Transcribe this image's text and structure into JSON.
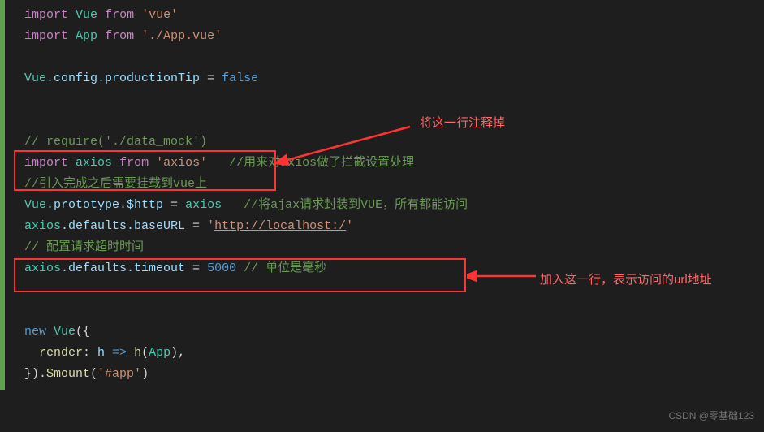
{
  "code": {
    "l1_k1": "import",
    "l1_v": "Vue",
    "l1_k2": "from",
    "l1_s": "'vue'",
    "l2_k1": "import",
    "l2_v": "App",
    "l2_k2": "from",
    "l2_s": "'./App.vue'",
    "l4_a": "Vue",
    "l4_b": ".config.productionTip",
    "l4_c": " = ",
    "l4_d": "false",
    "l7": "// require('./data_mock')",
    "l8_k1": "import",
    "l8_v": "axios",
    "l8_k2": "from",
    "l8_s": "'axios'",
    "l8_c": "   //用来对axios做了拦截设置处理",
    "l9": "//引入完成之后需要挂载到vue上",
    "l10_a": "Vue",
    "l10_b": ".prototype.$http",
    "l10_c": " = ",
    "l10_d": "axios",
    "l10_e": "   //将ajax请求封装到VUE，所有都能访问",
    "l11_a": "axios",
    "l11_b": ".defaults.baseURL",
    "l11_c": " = ",
    "l11_d": "'",
    "l11_url": "http://localhost:/",
    "l11_e": "'",
    "l12": "// 配置请求超时时间",
    "l13_a": "axios",
    "l13_b": ".defaults.timeout",
    "l13_c": " = ",
    "l13_d": "5000",
    "l13_e": " // 单位是毫秒",
    "l16_k": "new",
    "l16_v": " Vue",
    "l16_p": "({",
    "l17_a": "  render",
    "l17_b": ": ",
    "l17_c": "h",
    "l17_d": " => ",
    "l17_e": "h",
    "l17_f": "(",
    "l17_g": "App",
    "l17_h": "),",
    "l18_a": "}).",
    "l18_b": "$mount",
    "l18_c": "(",
    "l18_d": "'#app'",
    "l18_e": ")"
  },
  "annotations": {
    "top": "将这一行注释掉",
    "right": "加入这一行，表示访问的url地址"
  },
  "watermark": "CSDN @零基础123"
}
